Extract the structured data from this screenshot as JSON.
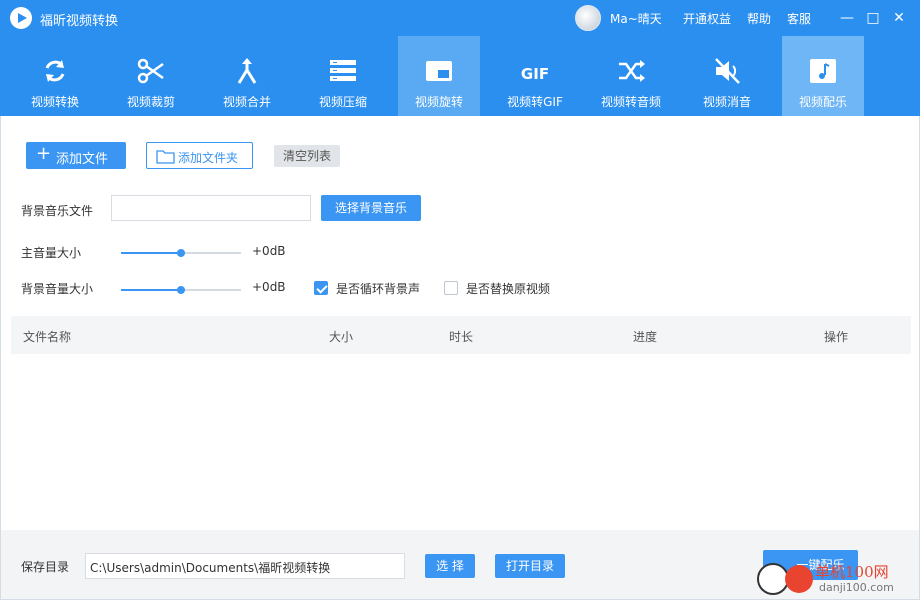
{
  "app": {
    "title": "福昕视频转换"
  },
  "user": {
    "name": "Ma~晴天"
  },
  "title_links": {
    "vip": "开通权益",
    "help": "帮助",
    "service": "客服"
  },
  "window_controls": {
    "minimize": "—",
    "maximize": "□",
    "close": "✕"
  },
  "tools": [
    {
      "label": "视频转换",
      "icon": "convert-icon"
    },
    {
      "label": "视频裁剪",
      "icon": "scissors-icon"
    },
    {
      "label": "视频合并",
      "icon": "merge-icon"
    },
    {
      "label": "视频压缩",
      "icon": "compress-icon"
    },
    {
      "label": "视频旋转",
      "icon": "rotate-icon"
    },
    {
      "label": "视频转GIF",
      "icon": "gif-icon"
    },
    {
      "label": "视频转音频",
      "icon": "shuffle-icon"
    },
    {
      "label": "视频消音",
      "icon": "mute-icon"
    },
    {
      "label": "视频配乐",
      "icon": "music-icon"
    }
  ],
  "actions": {
    "add_file": "添加文件",
    "add_folder": "添加文件夹",
    "clear_list": "清空列表"
  },
  "bgm": {
    "label": "背景音乐文件",
    "value": "",
    "button": "选择背景音乐"
  },
  "main_volume": {
    "label": "主音量大小",
    "value_text": "+0dB",
    "level": 0.5
  },
  "bg_volume": {
    "label": "背景音量大小",
    "value_text": "+0dB",
    "level": 0.5
  },
  "options": {
    "loop_bgm": {
      "label": "是否循环背景声",
      "checked": true
    },
    "replace_original": {
      "label": "是否替换原视频",
      "checked": false
    }
  },
  "table": {
    "columns": [
      "文件名称",
      "大小",
      "时长",
      "进度",
      "操作"
    ]
  },
  "footer": {
    "save_label": "保存目录",
    "save_path": "C:\\Users\\admin\\Documents\\福昕视频转换",
    "choose_button": "选 择",
    "open_button": "打开目录",
    "run_button": "一键配乐"
  },
  "watermark": {
    "text1": "单机100网",
    "text2": "danji100.com"
  }
}
